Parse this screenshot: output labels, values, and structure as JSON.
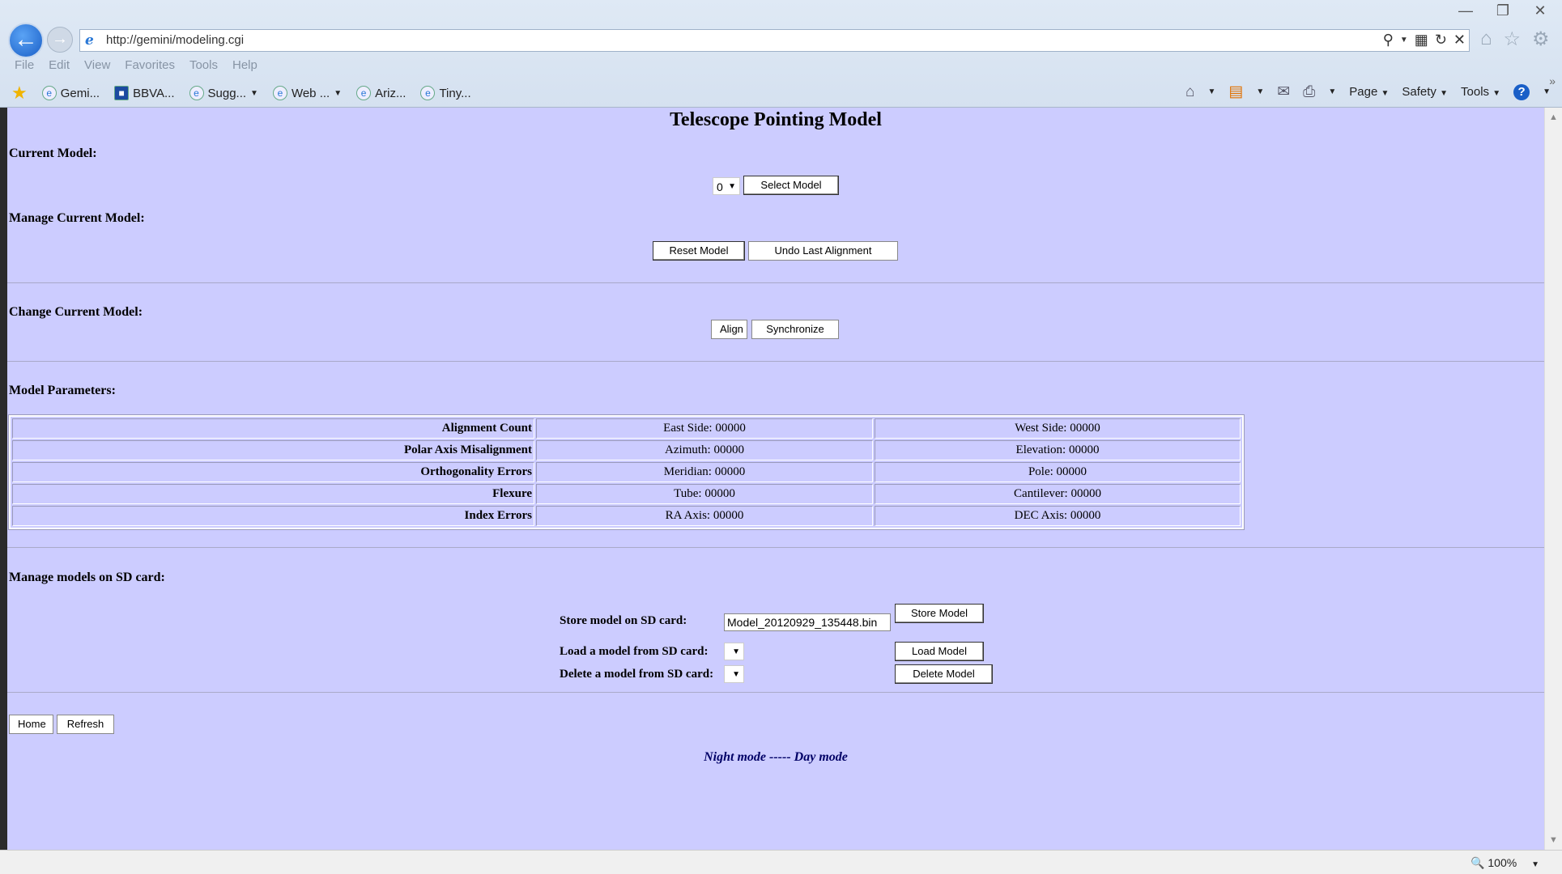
{
  "browser": {
    "url": "http://gemini/modeling.cgi",
    "menu": [
      "File",
      "Edit",
      "View",
      "Favorites",
      "Tools",
      "Help"
    ],
    "favorites": [
      {
        "label": "Gemi..."
      },
      {
        "label": "BBVA..."
      },
      {
        "label": "Sugg..."
      },
      {
        "label": "Web ..."
      },
      {
        "label": "Ariz..."
      },
      {
        "label": "Tiny..."
      }
    ],
    "commands": {
      "page": "Page",
      "safety": "Safety",
      "tools": "Tools"
    },
    "zoom": "100%"
  },
  "page": {
    "title": "Telescope Pointing Model",
    "current_model": {
      "heading": "Current Model:",
      "selected": "0",
      "select_button": "Select Model"
    },
    "manage_current": {
      "heading": "Manage Current Model:",
      "reset_button": "Reset Model",
      "undo_button": "Undo Last Alignment"
    },
    "change_current": {
      "heading": "Change Current Model:",
      "align_button": "Align",
      "sync_button": "Synchronize"
    },
    "parameters": {
      "heading": "Model Parameters:",
      "rows": [
        {
          "label": "Alignment Count",
          "a": "East Side: 00000",
          "b": "West Side: 00000"
        },
        {
          "label": "Polar Axis Misalignment",
          "a": "Azimuth: 00000",
          "b": "Elevation: 00000"
        },
        {
          "label": "Orthogonality Errors",
          "a": "Meridian: 00000",
          "b": "Pole: 00000"
        },
        {
          "label": "Flexure",
          "a": "Tube: 00000",
          "b": "Cantilever: 00000"
        },
        {
          "label": "Index Errors",
          "a": "RA Axis: 00000",
          "b": "DEC Axis: 00000"
        }
      ]
    },
    "sd_card": {
      "heading": "Manage models on SD card:",
      "store_label": "Store model on SD card:",
      "store_value": "Model_20120929_135448.bin",
      "store_button": "Store Model",
      "load_label": "Load a model from SD card:",
      "load_button": "Load Model",
      "delete_label": "Delete a model from SD card:",
      "delete_button": "Delete Model"
    },
    "footer": {
      "home_button": "Home",
      "refresh_button": "Refresh",
      "night_mode": "Night mode",
      "separator": " ----- ",
      "day_mode": "Day mode"
    }
  }
}
